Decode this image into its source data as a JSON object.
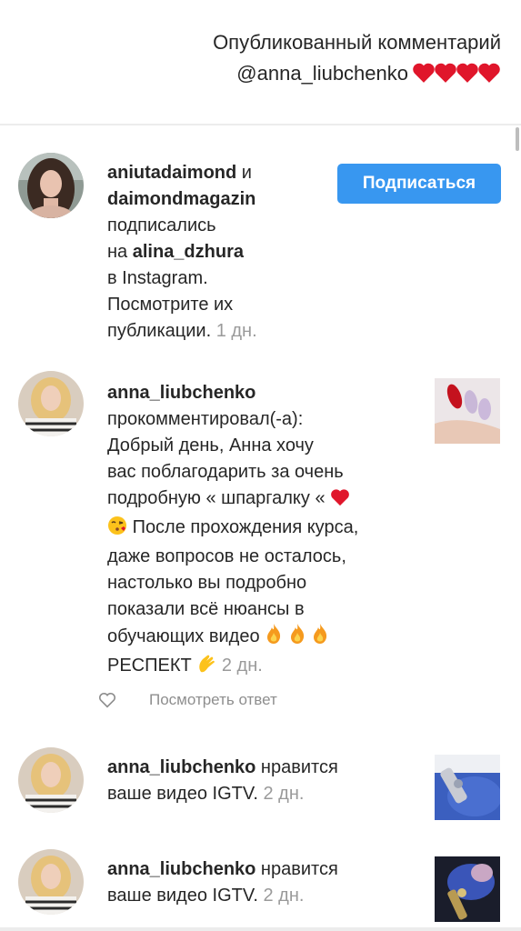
{
  "caption": {
    "line1": "Опубликованный комментарий",
    "line2": "@anna_liubchenko"
  },
  "notifications": [
    {
      "user1": "aniutadaimond",
      "and": " и ",
      "user2": "daimondmagazin",
      "text1": "подписались",
      "text2": "на ",
      "target": "alina_dzhura",
      "text3": "в Instagram.",
      "text4": "Посмотрите их",
      "text5": "публикации.",
      "time": "1 дн.",
      "button": "Подписаться"
    },
    {
      "user": "anna_liubchenko",
      "action": "прокомментировал(-а):",
      "lines": [
        "Добрый день,  Анна хочу",
        "вас поблагодарить за очень",
        "подробную « шпаргалку «",
        "После прохождения курса,",
        "даже вопросов не осталось,",
        "настолько вы подробно",
        "показали всё нюансы в",
        "обучающих видео",
        "РЕСПЕКТ"
      ],
      "time": "2 дн.",
      "reply": "Посмотреть ответ"
    },
    {
      "user": "anna_liubchenko",
      "action": " нравится",
      "line2": "ваше видео IGTV.",
      "time": "2 дн."
    },
    {
      "user": "anna_liubchenko",
      "action": " нравится",
      "line2": "ваше видео IGTV.",
      "time": "2 дн."
    }
  ],
  "icons": {
    "hearts": "red-heart-icon",
    "kiss": "kissing-face-icon",
    "fire": "fire-icon",
    "clap": "clapping-hands-icon",
    "like": "heart-outline-icon"
  },
  "colors": {
    "accent": "#3897f0",
    "heart": "#e0162b",
    "muted": "#9a9a9a"
  }
}
